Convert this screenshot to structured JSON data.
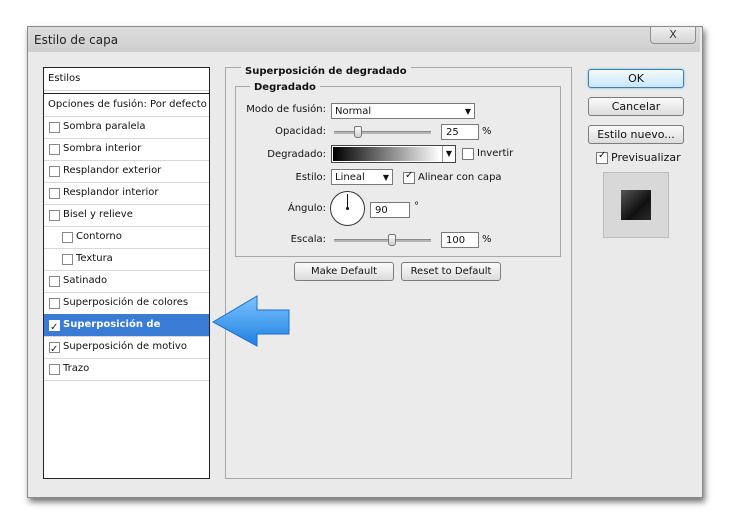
{
  "window": {
    "title": "Estilo de capa",
    "close_label": "X"
  },
  "styles_panel": {
    "header": "Estilos",
    "blend_options": "Opciones de fusión: Por defecto",
    "items": [
      {
        "label": "Sombra paralela",
        "checked": false,
        "indent": false,
        "selected": false
      },
      {
        "label": "Sombra interior",
        "checked": false,
        "indent": false,
        "selected": false
      },
      {
        "label": "Resplandor exterior",
        "checked": false,
        "indent": false,
        "selected": false
      },
      {
        "label": "Resplandor interior",
        "checked": false,
        "indent": false,
        "selected": false
      },
      {
        "label": "Bisel y relieve",
        "checked": false,
        "indent": false,
        "selected": false
      },
      {
        "label": "Contorno",
        "checked": false,
        "indent": true,
        "selected": false
      },
      {
        "label": "Textura",
        "checked": false,
        "indent": true,
        "selected": false
      },
      {
        "label": "Satinado",
        "checked": false,
        "indent": false,
        "selected": false
      },
      {
        "label": "Superposición de colores",
        "checked": false,
        "indent": false,
        "selected": false
      },
      {
        "label": "Superposición de degradado",
        "checked": true,
        "indent": false,
        "selected": true
      },
      {
        "label": "Superposición de motivo",
        "checked": true,
        "indent": false,
        "selected": false
      },
      {
        "label": "Trazo",
        "checked": false,
        "indent": false,
        "selected": false
      }
    ]
  },
  "gradient_overlay": {
    "section_title": "Superposición de degradado",
    "group_title": "Degradado",
    "blend_mode_label": "Modo de fusión:",
    "blend_mode_value": "Normal",
    "opacity_label": "Opacidad:",
    "opacity_value": "25",
    "opacity_fraction": 0.25,
    "percent": "%",
    "gradient_label": "Degradado:",
    "invert_label": "Invertir",
    "invert_checked": false,
    "style_label": "Estilo:",
    "style_value": "Lineal",
    "align_label": "Alinear con capa",
    "align_checked": true,
    "angle_label": "Ángulo:",
    "angle_value": "90",
    "degree": "°",
    "scale_label": "Escala:",
    "scale_value": "100",
    "scale_fraction": 0.6,
    "make_default": "Make Default",
    "reset_default": "Reset to Default"
  },
  "actions": {
    "ok": "OK",
    "cancel": "Cancelar",
    "new_style": "Estilo nuevo...",
    "preview_label": "Previsualizar",
    "preview_checked": true
  },
  "colors": {
    "selection": "#3a7bd5",
    "arrow": "#2f8fe8",
    "ok_border": "#3c7fb1"
  }
}
